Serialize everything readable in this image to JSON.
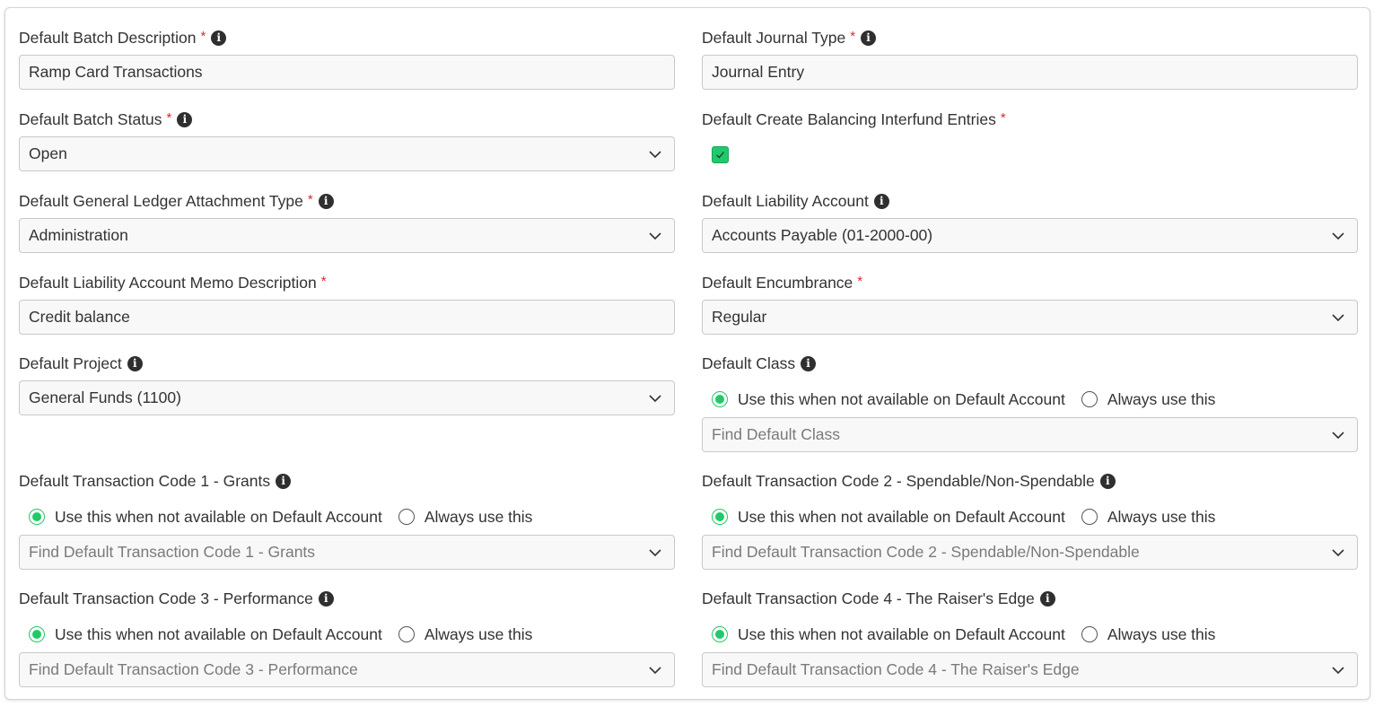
{
  "left": {
    "batch_description": {
      "label": "Default Batch Description",
      "required": "*",
      "value": "Ramp Card Transactions"
    },
    "batch_status": {
      "label": "Default Batch Status",
      "required": "*",
      "value": "Open"
    },
    "gl_attachment_type": {
      "label": "Default General Ledger Attachment Type",
      "required": "*",
      "value": "Administration"
    },
    "liability_memo": {
      "label": "Default Liability Account Memo Description",
      "required": "*",
      "value": "Credit balance"
    },
    "project": {
      "label": "Default Project",
      "value": "General Funds (1100)"
    },
    "tx_code_1": {
      "label": "Default Transaction Code 1 - Grants",
      "option_a": "Use this when not available on Default Account",
      "option_b": "Always use this",
      "selected": "option_a",
      "placeholder": "Find Default Transaction Code 1 - Grants"
    },
    "tx_code_3": {
      "label": "Default Transaction Code 3 - Performance",
      "option_a": "Use this when not available on Default Account",
      "option_b": "Always use this",
      "selected": "option_a",
      "placeholder": "Find Default Transaction Code 3 - Performance"
    }
  },
  "right": {
    "journal_type": {
      "label": "Default Journal Type",
      "required": "*",
      "value": "Journal Entry"
    },
    "balancing_interfund": {
      "label": "Default Create Balancing Interfund Entries",
      "required": "*",
      "checked": true
    },
    "liability_account": {
      "label": "Default Liability Account",
      "value": "Accounts Payable (01-2000-00)"
    },
    "encumbrance": {
      "label": "Default Encumbrance",
      "required": "*",
      "value": "Regular"
    },
    "class": {
      "label": "Default Class",
      "option_a": "Use this when not available on Default Account",
      "option_b": "Always use this",
      "selected": "option_a",
      "placeholder": "Find Default Class"
    },
    "tx_code_2": {
      "label": "Default Transaction Code 2 - Spendable/Non-Spendable",
      "option_a": "Use this when not available on Default Account",
      "option_b": "Always use this",
      "selected": "option_a",
      "placeholder": "Find Default Transaction Code 2 - Spendable/Non-Spendable"
    },
    "tx_code_4": {
      "label": "Default Transaction Code 4 - The Raiser's Edge",
      "option_a": "Use this when not available on Default Account",
      "option_b": "Always use this",
      "selected": "option_a",
      "placeholder": "Find Default Transaction Code 4 - The Raiser's Edge"
    }
  },
  "icons": {
    "info": "info-icon",
    "chevron": "chevron-down-icon",
    "check": "check-icon"
  },
  "colors": {
    "accent": "#21c96b",
    "required": "#e0262d",
    "border": "#c9c9c9",
    "input_bg": "#f8f8f8"
  }
}
